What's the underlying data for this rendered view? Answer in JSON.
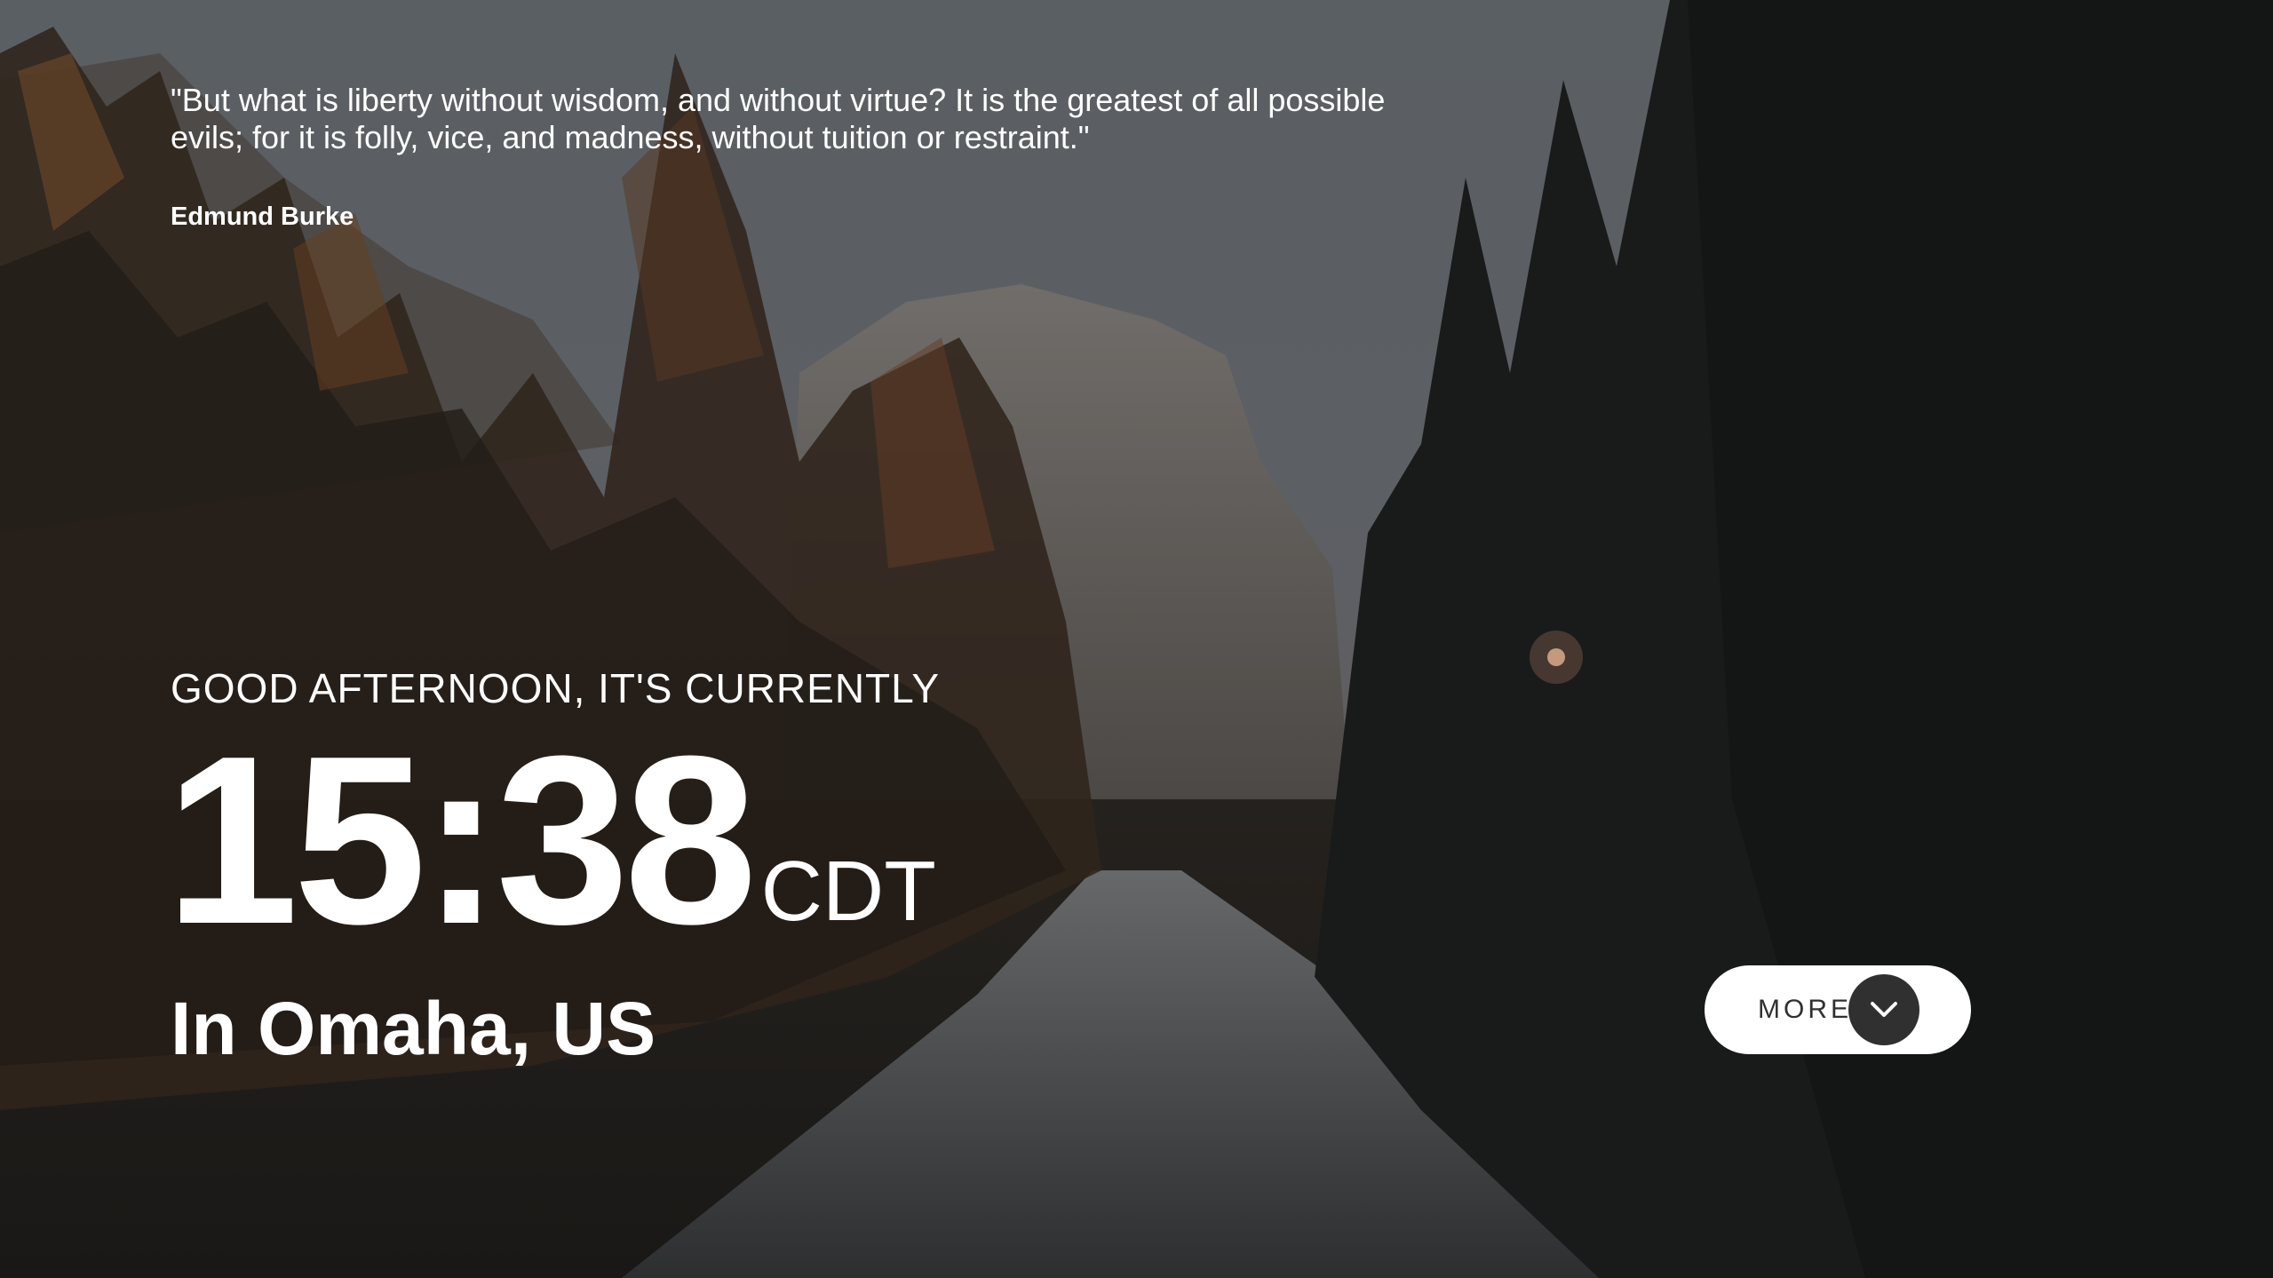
{
  "quote": {
    "text": "\"But what is liberty without wisdom, and without virtue? It is the greatest of all possible evils; for it is folly, vice, and madness, without tuition or restraint.\"",
    "author": "Edmund Burke"
  },
  "clock": {
    "greeting": "GOOD AFTERNOON, IT'S CURRENTLY",
    "time": "15:38",
    "timezone": "CDT",
    "location": "In Omaha, US"
  },
  "more_button": {
    "label": "MORE",
    "icon": "chevron-down-icon"
  },
  "colors": {
    "text": "#ffffff",
    "button_bg": "#ffffff",
    "button_text": "#303030",
    "icon_bg": "#303030"
  }
}
